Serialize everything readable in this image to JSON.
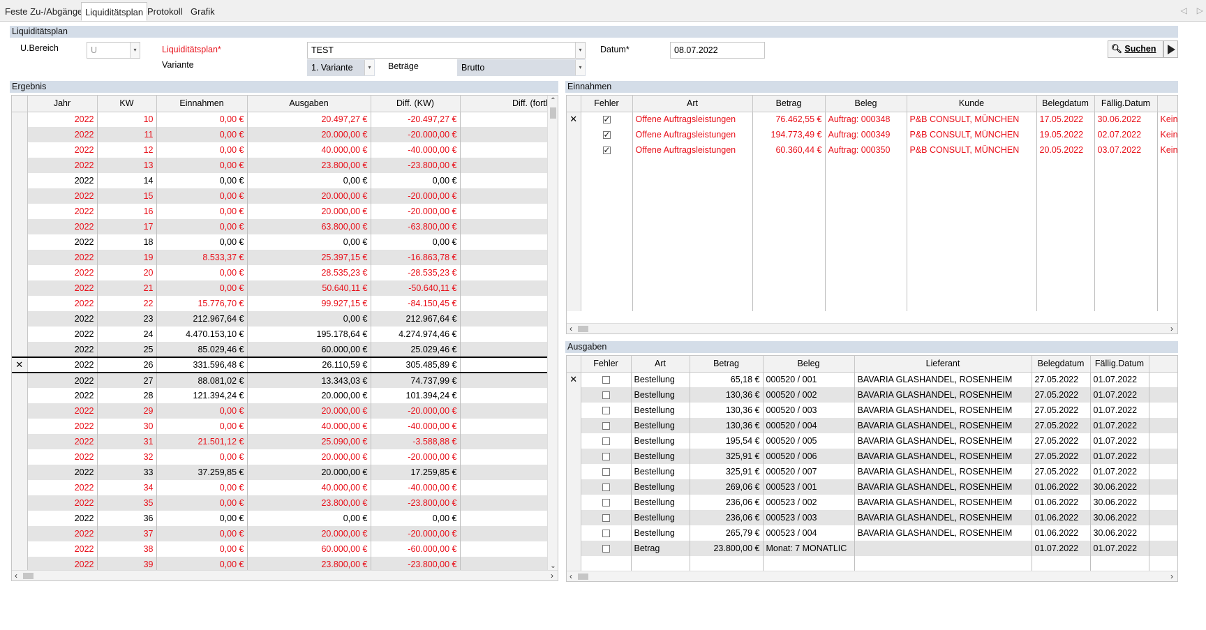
{
  "tabs": [
    "Feste Zu-/Abgänge",
    "Liquiditätsplan",
    "Protokoll",
    "Grafik"
  ],
  "sections": {
    "main": "Liquiditätsplan",
    "result": "Ergebnis",
    "income": "Einnahmen",
    "expenses": "Ausgaben"
  },
  "form": {
    "ubereich_label": "U.Bereich",
    "ubereich_value": "U",
    "plan_label": "Liquiditätsplan*",
    "plan_value": "TEST",
    "variante_label": "Variante",
    "variante_value": "1. Variante",
    "betraege_label": "Beträge",
    "betraege_value": "Brutto",
    "datum_label": "Datum*",
    "datum_value": "08.07.2022",
    "search_label": "Suchen"
  },
  "result_table": {
    "headers": [
      "Jahr",
      "KW",
      "Einnahmen",
      "Ausgaben",
      "Diff. (KW)",
      "Diff. (fortl"
    ],
    "rows": [
      {
        "jahr": "2022",
        "kw": "10",
        "ein": "0,00 €",
        "aus": "20.497,27 €",
        "diff": "-20.497,27 €",
        "red": true
      },
      {
        "jahr": "2022",
        "kw": "11",
        "ein": "0,00 €",
        "aus": "20.000,00 €",
        "diff": "-20.000,00 €",
        "red": true
      },
      {
        "jahr": "2022",
        "kw": "12",
        "ein": "0,00 €",
        "aus": "40.000,00 €",
        "diff": "-40.000,00 €",
        "red": true
      },
      {
        "jahr": "2022",
        "kw": "13",
        "ein": "0,00 €",
        "aus": "23.800,00 €",
        "diff": "-23.800,00 €",
        "red": true
      },
      {
        "jahr": "2022",
        "kw": "14",
        "ein": "0,00 €",
        "aus": "0,00 €",
        "diff": "0,00 €",
        "red": false
      },
      {
        "jahr": "2022",
        "kw": "15",
        "ein": "0,00 €",
        "aus": "20.000,00 €",
        "diff": "-20.000,00 €",
        "red": true
      },
      {
        "jahr": "2022",
        "kw": "16",
        "ein": "0,00 €",
        "aus": "20.000,00 €",
        "diff": "-20.000,00 €",
        "red": true
      },
      {
        "jahr": "2022",
        "kw": "17",
        "ein": "0,00 €",
        "aus": "63.800,00 €",
        "diff": "-63.800,00 €",
        "red": true
      },
      {
        "jahr": "2022",
        "kw": "18",
        "ein": "0,00 €",
        "aus": "0,00 €",
        "diff": "0,00 €",
        "red": false
      },
      {
        "jahr": "2022",
        "kw": "19",
        "ein": "8.533,37 €",
        "aus": "25.397,15 €",
        "diff": "-16.863,78 €",
        "red": true
      },
      {
        "jahr": "2022",
        "kw": "20",
        "ein": "0,00 €",
        "aus": "28.535,23 €",
        "diff": "-28.535,23 €",
        "red": true
      },
      {
        "jahr": "2022",
        "kw": "21",
        "ein": "0,00 €",
        "aus": "50.640,11 €",
        "diff": "-50.640,11 €",
        "red": true
      },
      {
        "jahr": "2022",
        "kw": "22",
        "ein": "15.776,70 €",
        "aus": "99.927,15 €",
        "diff": "-84.150,45 €",
        "red": true
      },
      {
        "jahr": "2022",
        "kw": "23",
        "ein": "212.967,64 €",
        "aus": "0,00 €",
        "diff": "212.967,64 €",
        "red": false
      },
      {
        "jahr": "2022",
        "kw": "24",
        "ein": "4.470.153,10 €",
        "aus": "195.178,64 €",
        "diff": "4.274.974,46 €",
        "red": false
      },
      {
        "jahr": "2022",
        "kw": "25",
        "ein": "85.029,46 €",
        "aus": "60.000,00 €",
        "diff": "25.029,46 €",
        "red": false
      },
      {
        "jahr": "2022",
        "kw": "26",
        "ein": "331.596,48 €",
        "aus": "26.110,59 €",
        "diff": "305.485,89 €",
        "red": false,
        "current": true
      },
      {
        "jahr": "2022",
        "kw": "27",
        "ein": "88.081,02 €",
        "aus": "13.343,03 €",
        "diff": "74.737,99 €",
        "red": false
      },
      {
        "jahr": "2022",
        "kw": "28",
        "ein": "121.394,24 €",
        "aus": "20.000,00 €",
        "diff": "101.394,24 €",
        "red": false
      },
      {
        "jahr": "2022",
        "kw": "29",
        "ein": "0,00 €",
        "aus": "20.000,00 €",
        "diff": "-20.000,00 €",
        "red": true
      },
      {
        "jahr": "2022",
        "kw": "30",
        "ein": "0,00 €",
        "aus": "40.000,00 €",
        "diff": "-40.000,00 €",
        "red": true
      },
      {
        "jahr": "2022",
        "kw": "31",
        "ein": "21.501,12 €",
        "aus": "25.090,00 €",
        "diff": "-3.588,88 €",
        "red": true
      },
      {
        "jahr": "2022",
        "kw": "32",
        "ein": "0,00 €",
        "aus": "20.000,00 €",
        "diff": "-20.000,00 €",
        "red": true
      },
      {
        "jahr": "2022",
        "kw": "33",
        "ein": "37.259,85 €",
        "aus": "20.000,00 €",
        "diff": "17.259,85 €",
        "red": false
      },
      {
        "jahr": "2022",
        "kw": "34",
        "ein": "0,00 €",
        "aus": "40.000,00 €",
        "diff": "-40.000,00 €",
        "red": true
      },
      {
        "jahr": "2022",
        "kw": "35",
        "ein": "0,00 €",
        "aus": "23.800,00 €",
        "diff": "-23.800,00 €",
        "red": true
      },
      {
        "jahr": "2022",
        "kw": "36",
        "ein": "0,00 €",
        "aus": "0,00 €",
        "diff": "0,00 €",
        "red": false
      },
      {
        "jahr": "2022",
        "kw": "37",
        "ein": "0,00 €",
        "aus": "20.000,00 €",
        "diff": "-20.000,00 €",
        "red": true
      },
      {
        "jahr": "2022",
        "kw": "38",
        "ein": "0,00 €",
        "aus": "60.000,00 €",
        "diff": "-60.000,00 €",
        "red": true
      },
      {
        "jahr": "2022",
        "kw": "39",
        "ein": "0,00 €",
        "aus": "23.800,00 €",
        "diff": "-23.800,00 €",
        "red": true
      }
    ]
  },
  "income_table": {
    "headers": [
      "Fehler",
      "Art",
      "Betrag",
      "Beleg",
      "Kunde",
      "Belegdatum",
      "Fällig.Datum",
      ""
    ],
    "rows": [
      {
        "checked": true,
        "art": "Offene Auftragsleistungen",
        "betrag": "76.462,55 €",
        "beleg": "Auftrag: 000348",
        "kunde": "P&B CONSULT, MÜNCHEN",
        "belegdatum": "17.05.2022",
        "faellig": "30.06.2022",
        "extra": "Kein Zah"
      },
      {
        "checked": true,
        "art": "Offene Auftragsleistungen",
        "betrag": "194.773,49 €",
        "beleg": "Auftrag: 000349",
        "kunde": "P&B CONSULT, MÜNCHEN",
        "belegdatum": "19.05.2022",
        "faellig": "02.07.2022",
        "extra": "Kein Zah"
      },
      {
        "checked": true,
        "art": "Offene Auftragsleistungen",
        "betrag": "60.360,44 €",
        "beleg": "Auftrag: 000350",
        "kunde": "P&B CONSULT, MÜNCHEN",
        "belegdatum": "20.05.2022",
        "faellig": "03.07.2022",
        "extra": "Kein Zah"
      }
    ]
  },
  "expense_table": {
    "headers": [
      "Fehler",
      "Art",
      "Betrag",
      "Beleg",
      "Lieferant",
      "Belegdatum",
      "Fällig.Datum",
      ""
    ],
    "rows": [
      {
        "art": "Bestellung",
        "betrag": "65,18 €",
        "beleg": "000520 / 001",
        "lieferant": "BAVARIA GLASHANDEL, ROSENHEIM",
        "belegdatum": "27.05.2022",
        "faellig": "01.07.2022"
      },
      {
        "art": "Bestellung",
        "betrag": "130,36 €",
        "beleg": "000520 / 002",
        "lieferant": "BAVARIA GLASHANDEL, ROSENHEIM",
        "belegdatum": "27.05.2022",
        "faellig": "01.07.2022"
      },
      {
        "art": "Bestellung",
        "betrag": "130,36 €",
        "beleg": "000520 / 003",
        "lieferant": "BAVARIA GLASHANDEL, ROSENHEIM",
        "belegdatum": "27.05.2022",
        "faellig": "01.07.2022"
      },
      {
        "art": "Bestellung",
        "betrag": "130,36 €",
        "beleg": "000520 / 004",
        "lieferant": "BAVARIA GLASHANDEL, ROSENHEIM",
        "belegdatum": "27.05.2022",
        "faellig": "01.07.2022"
      },
      {
        "art": "Bestellung",
        "betrag": "195,54 €",
        "beleg": "000520 / 005",
        "lieferant": "BAVARIA GLASHANDEL, ROSENHEIM",
        "belegdatum": "27.05.2022",
        "faellig": "01.07.2022"
      },
      {
        "art": "Bestellung",
        "betrag": "325,91 €",
        "beleg": "000520 / 006",
        "lieferant": "BAVARIA GLASHANDEL, ROSENHEIM",
        "belegdatum": "27.05.2022",
        "faellig": "01.07.2022"
      },
      {
        "art": "Bestellung",
        "betrag": "325,91 €",
        "beleg": "000520 / 007",
        "lieferant": "BAVARIA GLASHANDEL, ROSENHEIM",
        "belegdatum": "27.05.2022",
        "faellig": "01.07.2022"
      },
      {
        "art": "Bestellung",
        "betrag": "269,06 €",
        "beleg": "000523 / 001",
        "lieferant": "BAVARIA GLASHANDEL, ROSENHEIM",
        "belegdatum": "01.06.2022",
        "faellig": "30.06.2022"
      },
      {
        "art": "Bestellung",
        "betrag": "236,06 €",
        "beleg": "000523 / 002",
        "lieferant": "BAVARIA GLASHANDEL, ROSENHEIM",
        "belegdatum": "01.06.2022",
        "faellig": "30.06.2022"
      },
      {
        "art": "Bestellung",
        "betrag": "236,06 €",
        "beleg": "000523 / 003",
        "lieferant": "BAVARIA GLASHANDEL, ROSENHEIM",
        "belegdatum": "01.06.2022",
        "faellig": "30.06.2022"
      },
      {
        "art": "Bestellung",
        "betrag": "265,79 €",
        "beleg": "000523 / 004",
        "lieferant": "BAVARIA GLASHANDEL, ROSENHEIM",
        "belegdatum": "01.06.2022",
        "faellig": "30.06.2022"
      },
      {
        "art": "Betrag",
        "betrag": "23.800,00 €",
        "beleg": "Monat: 7 MONATLIC",
        "lieferant": "",
        "belegdatum": "01.07.2022",
        "faellig": "01.07.2022"
      }
    ]
  },
  "colors": {
    "negative": "#e8101a",
    "section_header": "#d4dde8",
    "row_alt": "#e4e4e4"
  },
  "icons": {
    "search": "magnifier-icon",
    "run": "play-icon",
    "row_marker": "x-marker-icon",
    "checkbox": "checkbox-icon"
  }
}
